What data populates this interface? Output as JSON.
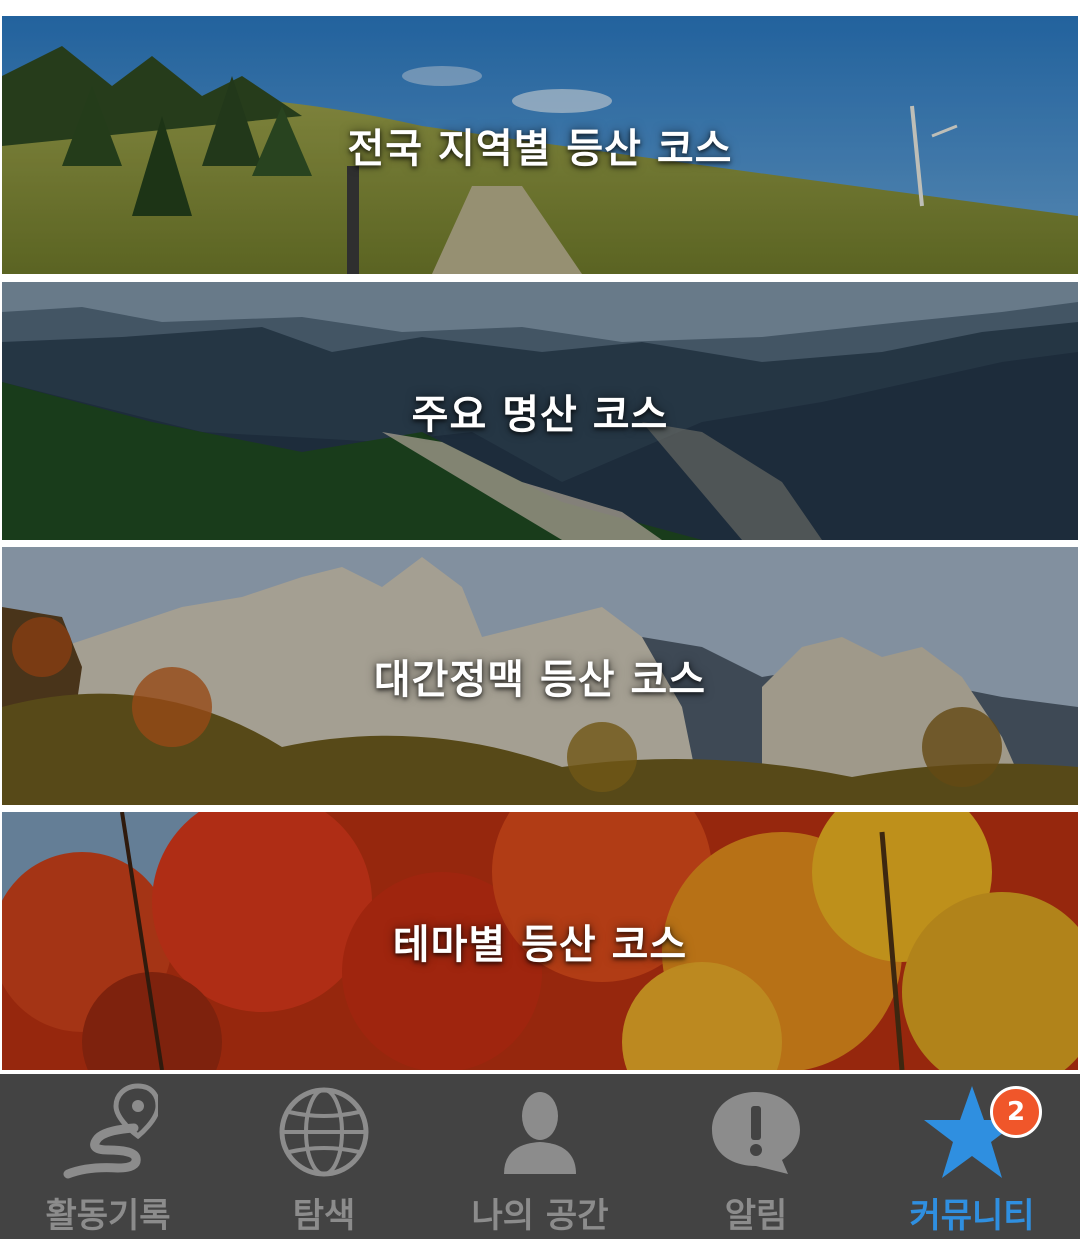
{
  "banners": [
    {
      "title": "전국 지역별 등산 코스"
    },
    {
      "title": "주요 명산 코스"
    },
    {
      "title": "대간정맥 등산 코스"
    },
    {
      "title": "테마별 등산 코스"
    }
  ],
  "tabbar": {
    "tabs": [
      {
        "label": "활동기록",
        "icon": "route-pin-icon"
      },
      {
        "label": "탐색",
        "icon": "globe-icon"
      },
      {
        "label": "나의 공간",
        "icon": "person-icon"
      },
      {
        "label": "알림",
        "icon": "alert-bubble-icon"
      },
      {
        "label": "커뮤니티",
        "icon": "star-icon",
        "active": true,
        "badge": "2"
      }
    ]
  },
  "colors": {
    "tabbar_bg": "#434343",
    "tab_inactive": "#8c8c8c",
    "tab_active": "#2f8fe0",
    "badge": "#f0562a"
  }
}
